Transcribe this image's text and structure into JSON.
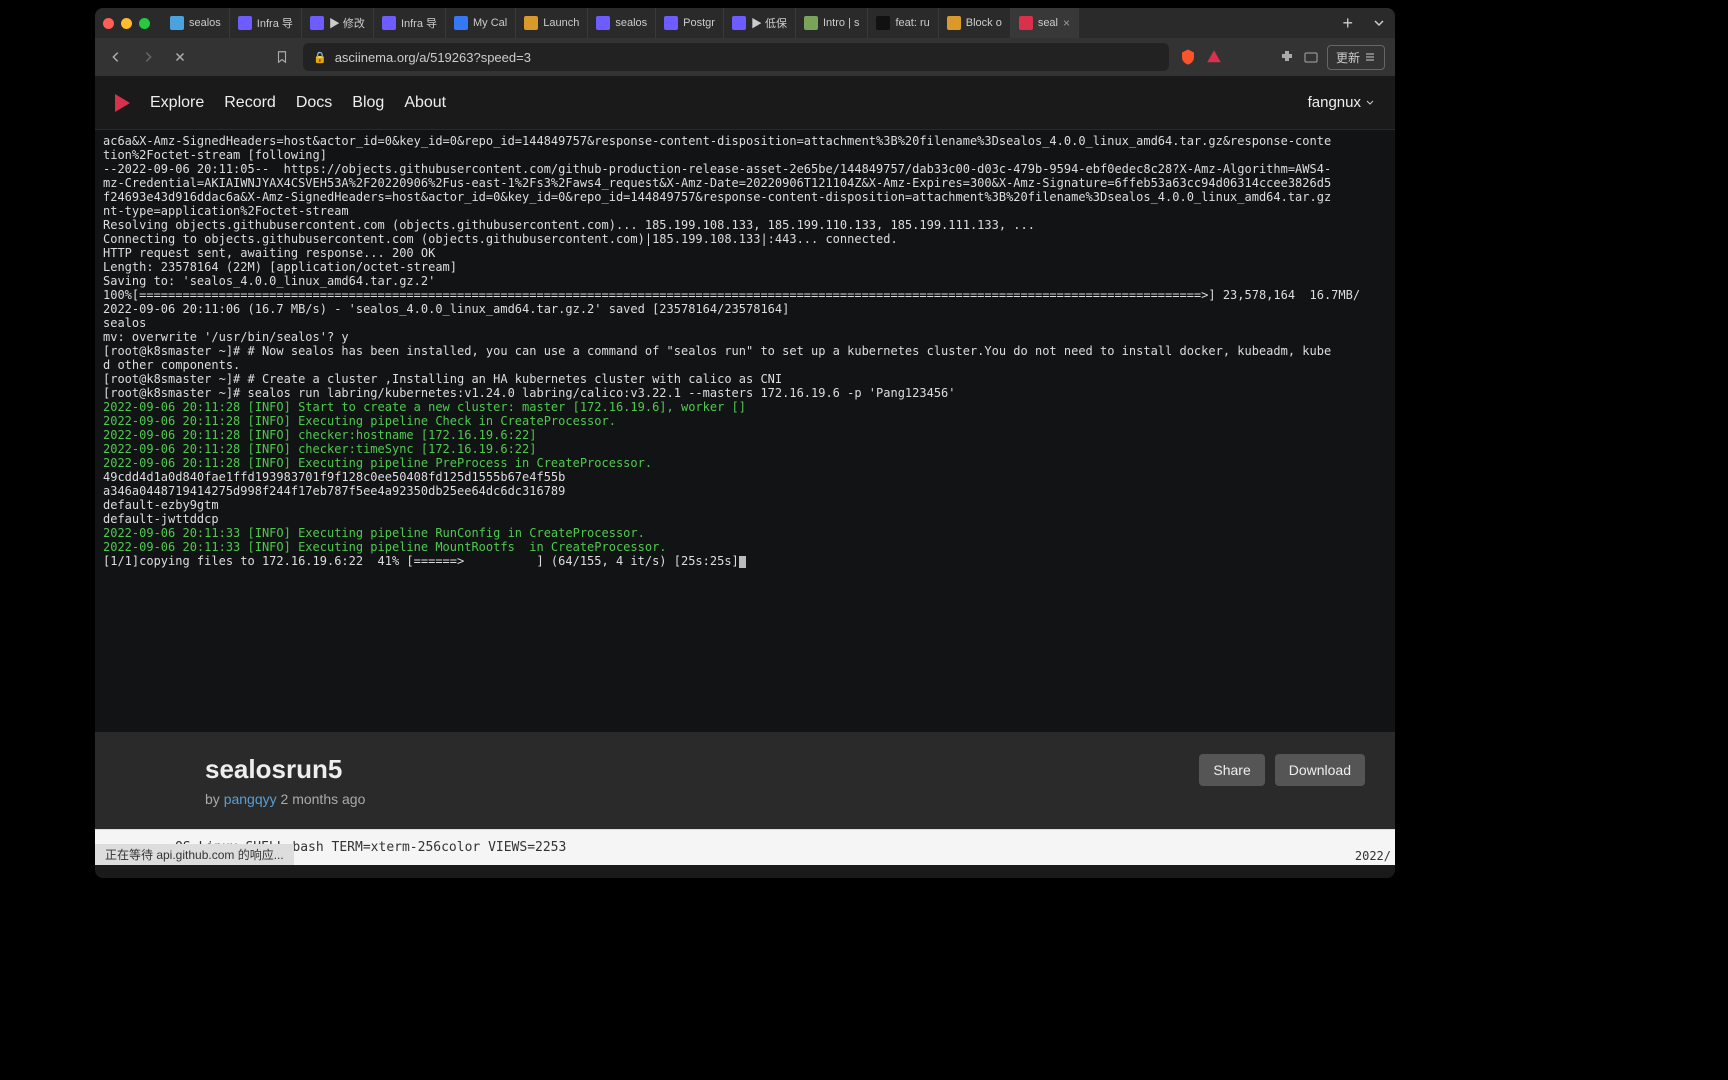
{
  "browser": {
    "tabs": [
      {
        "label": "sealos",
        "favicon": "#4aa3df"
      },
      {
        "label": "Infra 导",
        "favicon": "#6d5cff"
      },
      {
        "label": "▶ 修改",
        "favicon": "#6d5cff"
      },
      {
        "label": "Infra 导",
        "favicon": "#6d5cff"
      },
      {
        "label": "My Cal",
        "favicon": "#3478f6"
      },
      {
        "label": "Launch",
        "favicon": "#d99a2b"
      },
      {
        "label": "sealos",
        "favicon": "#6d5cff"
      },
      {
        "label": "Postgr",
        "favicon": "#6d5cff"
      },
      {
        "label": "▶ 低保",
        "favicon": "#6d5cff"
      },
      {
        "label": "Intro | s",
        "favicon": "#7aa35a"
      },
      {
        "label": "feat: ru",
        "favicon": "#111"
      },
      {
        "label": "Block o",
        "favicon": "#d99a2b"
      },
      {
        "label": "seal",
        "favicon": "#d9304c",
        "active": true
      }
    ],
    "url": "asciinema.org/a/519263?speed=3",
    "update_button": "更新",
    "status_text": "正在等待 api.github.com 的响应..."
  },
  "site": {
    "nav": [
      "Explore",
      "Record",
      "Docs",
      "Blog",
      "About"
    ],
    "user": "fangnux"
  },
  "terminal_lines": [
    {
      "t": "ac6a&X-Amz-SignedHeaders=host&actor_id=0&key_id=0&repo_id=144849757&response-content-disposition=attachment%3B%20filename%3Dsealos_4.0.0_linux_amd64.tar.gz&response-conte"
    },
    {
      "t": "tion%2Foctet-stream [following]"
    },
    {
      "t": "--2022-09-06 20:11:05--  https://objects.githubusercontent.com/github-production-release-asset-2e65be/144849757/dab33c00-d03c-479b-9594-ebf0edec8c28?X-Amz-Algorithm=AWS4-"
    },
    {
      "t": "mz-Credential=AKIAIWNJYAX4CSVEH53A%2F20220906%2Fus-east-1%2Fs3%2Faws4_request&X-Amz-Date=20220906T121104Z&X-Amz-Expires=300&X-Amz-Signature=6ffeb53a63cc94d06314ccee3826d5"
    },
    {
      "t": "f24693e43d916ddac6a&X-Amz-SignedHeaders=host&actor_id=0&key_id=0&repo_id=144849757&response-content-disposition=attachment%3B%20filename%3Dsealos_4.0.0_linux_amd64.tar.gz"
    },
    {
      "t": "nt-type=application%2Foctet-stream"
    },
    {
      "t": "Resolving objects.githubusercontent.com (objects.githubusercontent.com)... 185.199.108.133, 185.199.110.133, 185.199.111.133, ..."
    },
    {
      "t": "Connecting to objects.githubusercontent.com (objects.githubusercontent.com)|185.199.108.133|:443... connected."
    },
    {
      "t": "HTTP request sent, awaiting response... 200 OK"
    },
    {
      "t": "Length: 23578164 (22M) [application/octet-stream]"
    },
    {
      "t": "Saving to: 'sealos_4.0.0_linux_amd64.tar.gz.2'"
    },
    {
      "t": ""
    },
    {
      "t": "100%[===================================================================================================================================================>] 23,578,164  16.7MB/"
    },
    {
      "t": ""
    },
    {
      "t": "2022-09-06 20:11:06 (16.7 MB/s) - 'sealos_4.0.0_linux_amd64.tar.gz.2' saved [23578164/23578164]"
    },
    {
      "t": ""
    },
    {
      "t": "sealos"
    },
    {
      "t": "mv: overwrite '/usr/bin/sealos'? y"
    },
    {
      "t": "[root@k8smaster ~]# # Now sealos has been installed, you can use a command of \"sealos run\" to set up a kubernetes cluster.You do not need to install docker, kubeadm, kube"
    },
    {
      "t": "d other components."
    },
    {
      "t": "[root@k8smaster ~]# # Create a cluster ,Installing an HA kubernetes cluster with calico as CNI"
    },
    {
      "t": "[root@k8smaster ~]# sealos run labring/kubernetes:v1.24.0 labring/calico:v3.22.1 --masters 172.16.19.6 -p 'Pang123456'"
    },
    {
      "t": "2022-09-06 20:11:28 [INFO] Start to create a new cluster: master [172.16.19.6], worker []",
      "c": "info-green"
    },
    {
      "t": "2022-09-06 20:11:28 [INFO] Executing pipeline Check in CreateProcessor.",
      "c": "info-green"
    },
    {
      "t": "2022-09-06 20:11:28 [INFO] checker:hostname [172.16.19.6:22]",
      "c": "info-green"
    },
    {
      "t": "2022-09-06 20:11:28 [INFO] checker:timeSync [172.16.19.6:22]",
      "c": "info-green"
    },
    {
      "t": "2022-09-06 20:11:28 [INFO] Executing pipeline PreProcess in CreateProcessor.",
      "c": "info-green"
    },
    {
      "t": "49cdd4d1a0d840fae1ffd193983701f9f128c0ee50408fd125d1555b67e4f55b"
    },
    {
      "t": "a346a0448719414275d998f244f17eb787f5ee4a92350db25ee64dc6dc316789"
    },
    {
      "t": "default-ezby9gtm"
    },
    {
      "t": "default-jwttddcp"
    },
    {
      "t": "2022-09-06 20:11:33 [INFO] Executing pipeline RunConfig in CreateProcessor.",
      "c": "info-green"
    },
    {
      "t": "2022-09-06 20:11:33 [INFO] Executing pipeline MountRootfs  in CreateProcessor.",
      "c": "info-green"
    },
    {
      "t": "[1/1]copying files to 172.16.19.6:22  41% [======>          ] (64/155, 4 it/s) [25s:25s]",
      "cursor": true
    }
  ],
  "cast": {
    "title": "sealosrun5",
    "by_prefix": "by ",
    "author": "pangqyy",
    "time_ago": " 2 months ago",
    "share": "Share",
    "download": "Download"
  },
  "footer": {
    "info_line": "OS=Linux SHELL=bash TERM=xterm-256color  VIEWS=2253",
    "right": "2022/"
  }
}
